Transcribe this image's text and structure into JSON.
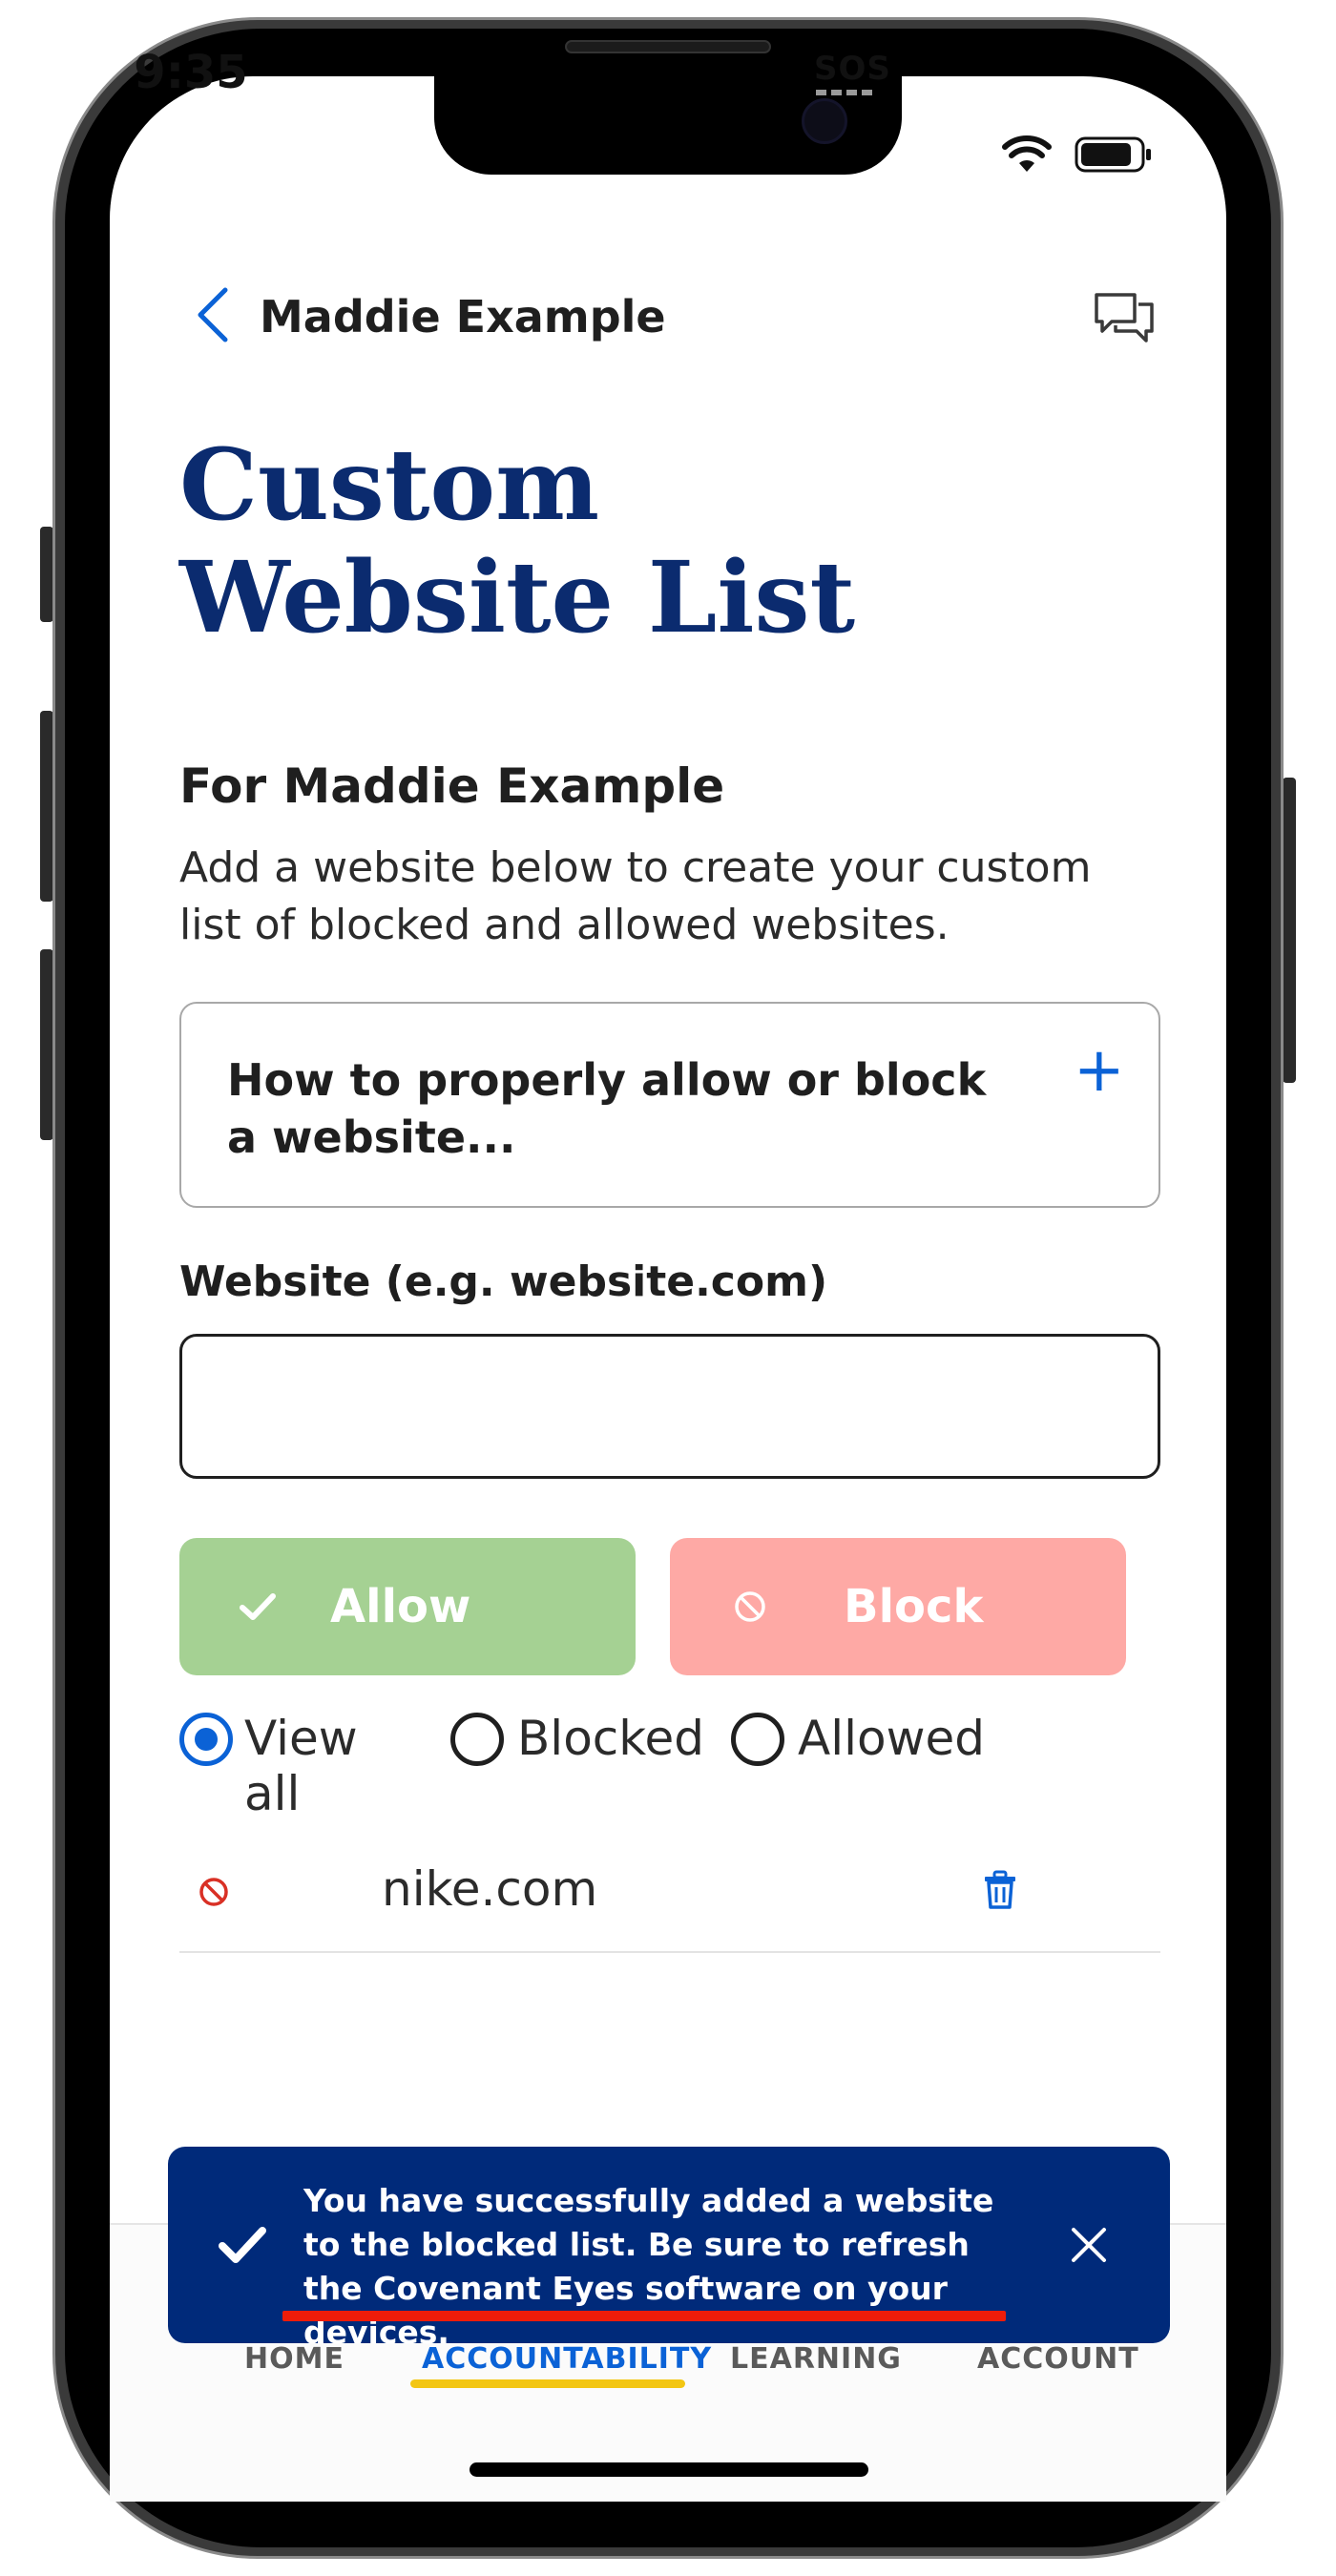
{
  "status_bar": {
    "time": "9:35",
    "carrier": "SOS"
  },
  "header": {
    "back_label": "Maddie Example"
  },
  "page": {
    "title": "Custom Website List",
    "subtitle": "For Maddie Example",
    "description": "Add a website below to create your custom list of blocked and allowed websites."
  },
  "accordion": {
    "label": "How to properly allow or block a website...",
    "toggle_symbol": "+"
  },
  "website_field": {
    "label": "Website (e.g. website.com)",
    "value": ""
  },
  "actions": {
    "allow_label": "Allow",
    "block_label": "Block"
  },
  "filters": [
    {
      "label": "View all",
      "selected": true
    },
    {
      "label": "Blocked",
      "selected": false
    },
    {
      "label": "Allowed",
      "selected": false
    }
  ],
  "website_list": [
    {
      "url": "nike.com",
      "status": "blocked"
    }
  ],
  "toast": {
    "message": "You have successfully added a website to the blocked list. Be sure to refresh the Covenant Eyes software on your devices."
  },
  "tabs": [
    {
      "label": "HOME",
      "active": false
    },
    {
      "label": "ACCOUNTABILITY",
      "active": true
    },
    {
      "label": "LEARNING",
      "active": false
    },
    {
      "label": "ACCOUNT",
      "active": false
    }
  ],
  "colors": {
    "title_navy": "#0b2b6f",
    "accent_blue": "#0b62d6",
    "allow_green": "#a5d193",
    "block_red": "#fea9a5",
    "toast_bg": "#002a7a",
    "tab_underline": "#f3c613",
    "blocked_icon_red": "#d93025"
  }
}
